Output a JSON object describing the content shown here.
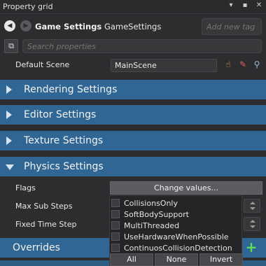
{
  "window": {
    "title": "Property grid",
    "controls": [
      "▾",
      "▪",
      "✕"
    ]
  },
  "header": {
    "asset_type": "Game Settings",
    "asset_name": "GameSettings",
    "tag_placeholder": "Add new tag"
  },
  "search": {
    "placeholder": "Search properties"
  },
  "default_scene": {
    "label": "Default Scene",
    "value": "MainScene"
  },
  "sections": [
    "Rendering Settings",
    "Editor Settings",
    "Texture Settings",
    "Physics Settings"
  ],
  "physics": {
    "flags_label": "Flags",
    "change_button": "Change values...",
    "max_sub_steps_label": "Max Sub Steps",
    "fixed_time_step_label": "Fixed Time Step",
    "flag_options": [
      "CollisionsOnly",
      "SoftBodySupport",
      "MultiThreaded",
      "UseHardwareWhenPossible",
      "ContinuosCollisionDetection"
    ],
    "all_button": "All",
    "none_button": "None",
    "invert_button": "Invert"
  },
  "overrides": {
    "label": "Overrides",
    "add_icon": "+"
  },
  "colors": {
    "section_bar": "#2f6693",
    "add_green": "#5ddc5d",
    "background": "#2d2d30"
  }
}
